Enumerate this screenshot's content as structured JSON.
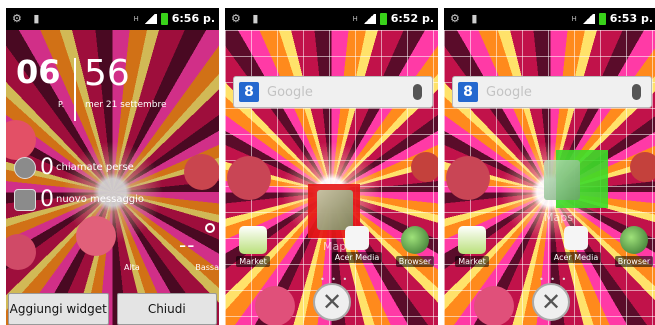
{
  "status": {
    "s1_time": "6:56 p.",
    "s2_time": "6:52 p.",
    "s3_time": "6:53 p."
  },
  "lock": {
    "hour": "06",
    "minute": "56",
    "ampm": "P.",
    "date": "mer 21 settembre",
    "missed_calls_count": "0",
    "missed_calls_label": "chiamate perse",
    "messages_count": "0",
    "messages_label": "nuovo messaggio",
    "temp": "--",
    "alta_label": "Alta",
    "bassa_label": "Bassa",
    "add_widget_label": "Aggiungi widget",
    "close_label": "Chiudi"
  },
  "search": {
    "placeholder": "Google",
    "g_letter": "8"
  },
  "dock": {
    "market": "Market",
    "acer_media": "Acer Media",
    "browser": "Browser"
  },
  "drag": {
    "maps_label": "Maps",
    "trash_glyph": "✕"
  },
  "colors": {
    "drop_invalid": "#e51414",
    "drop_valid": "#3cdc28",
    "battery": "#39d21a"
  }
}
